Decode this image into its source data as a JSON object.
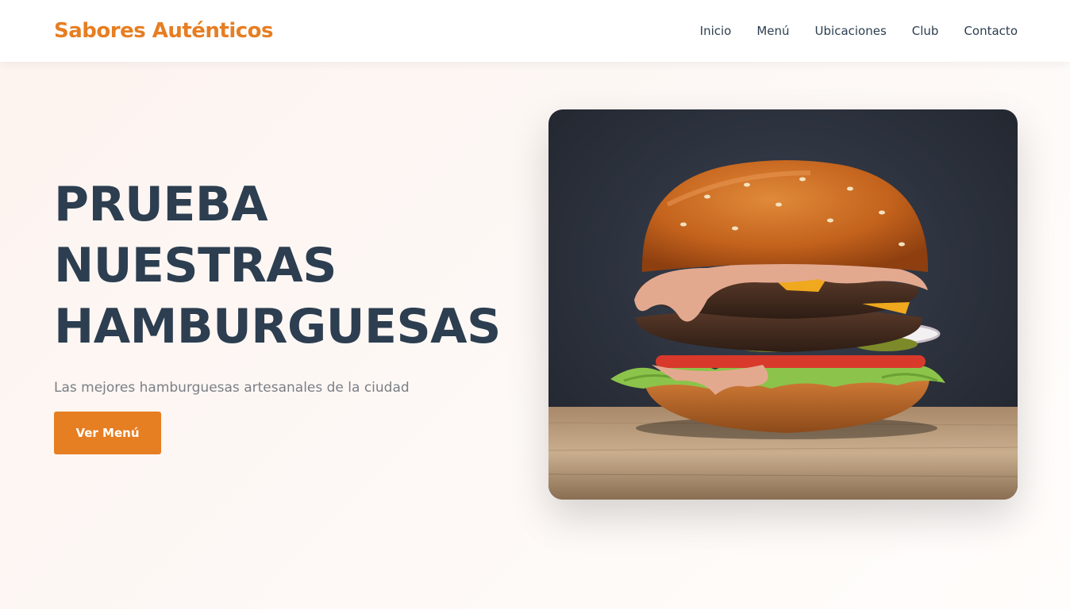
{
  "brand": {
    "name": "Sabores Auténticos",
    "accent": "#e67e22"
  },
  "nav": {
    "items": [
      {
        "label": "Inicio"
      },
      {
        "label": "Menú"
      },
      {
        "label": "Ubicaciones"
      },
      {
        "label": "Club"
      },
      {
        "label": "Contacto"
      }
    ]
  },
  "hero": {
    "title_lines": [
      "PRUEBA",
      "NUESTRAS",
      "HAMBURGUESAS"
    ],
    "subtitle": "Las mejores hamburguesas artesanales de la ciudad",
    "cta_label": "Ver Menú",
    "image": {
      "subject": "burger-photo"
    }
  },
  "colors": {
    "text_dark": "#2c3e50",
    "text_muted": "#7a7f85",
    "header_bg": "#ffffff"
  }
}
